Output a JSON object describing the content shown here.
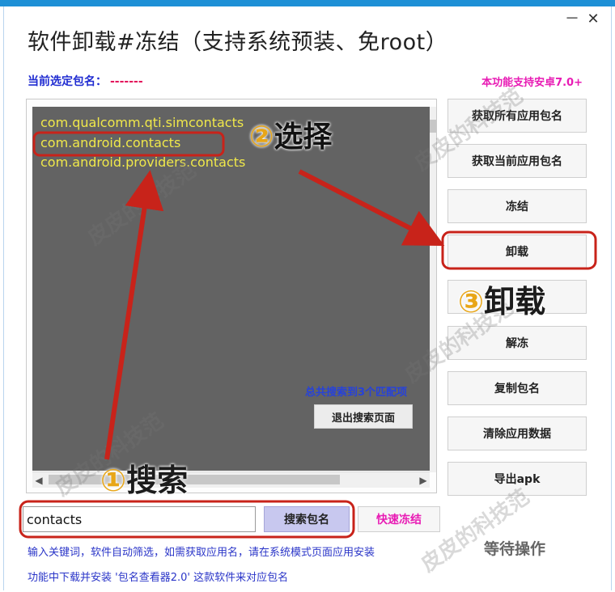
{
  "window": {
    "title": "软件卸载#冻结（支持系统预装、免root）",
    "minimize_glyph": "－",
    "close_glyph": "✕"
  },
  "selected": {
    "label": "当前选定包名：",
    "value": "-------"
  },
  "support_note": "本功能支持安卓7.0+",
  "package_list": {
    "items": [
      "com.qualcomm.qti.simcontacts",
      "com.android.contacts",
      "com.android.providers.contacts"
    ],
    "match_count_text": "总共搜索到3个匹配项",
    "exit_search_label": "退出搜索页面"
  },
  "scrollbar": {
    "left_arrow": "◀",
    "right_arrow": "▶"
  },
  "side_buttons": {
    "get_all": "获取所有应用包名",
    "get_current": "获取当前应用包名",
    "freeze": "冻结",
    "uninstall": "卸载",
    "hidden": "",
    "unfreeze": "解冻",
    "copy_name": "复制包名",
    "clear_data": "清除应用数据",
    "export_apk": "导出apk"
  },
  "search": {
    "value": "contacts",
    "button_label": "搜索包名",
    "quick_freeze_label": "快速冻结"
  },
  "status_text": "等待操作",
  "hints": {
    "line1": "输入关键词，软件自动筛选，如需获取应用名，请在系统模式页面应用安装",
    "line2": "功能中下载并安装 '包名查看器2.0' 这款软件来对应包名"
  },
  "annotations": {
    "select_num": "②",
    "select_text": "选择",
    "uninstall_num": "③",
    "uninstall_text": "卸载",
    "search_num": "①",
    "search_text": "搜索"
  },
  "watermark": "皮皮的科技范",
  "colors": {
    "accent_top": "#1e90d6",
    "list_bg": "#636363",
    "package_text": "#f0e84a",
    "annotation_red": "#c8231a",
    "label_blue": "#1f2bd1",
    "magenta": "#e81bb4",
    "annotation_orange": "#e8a618"
  }
}
